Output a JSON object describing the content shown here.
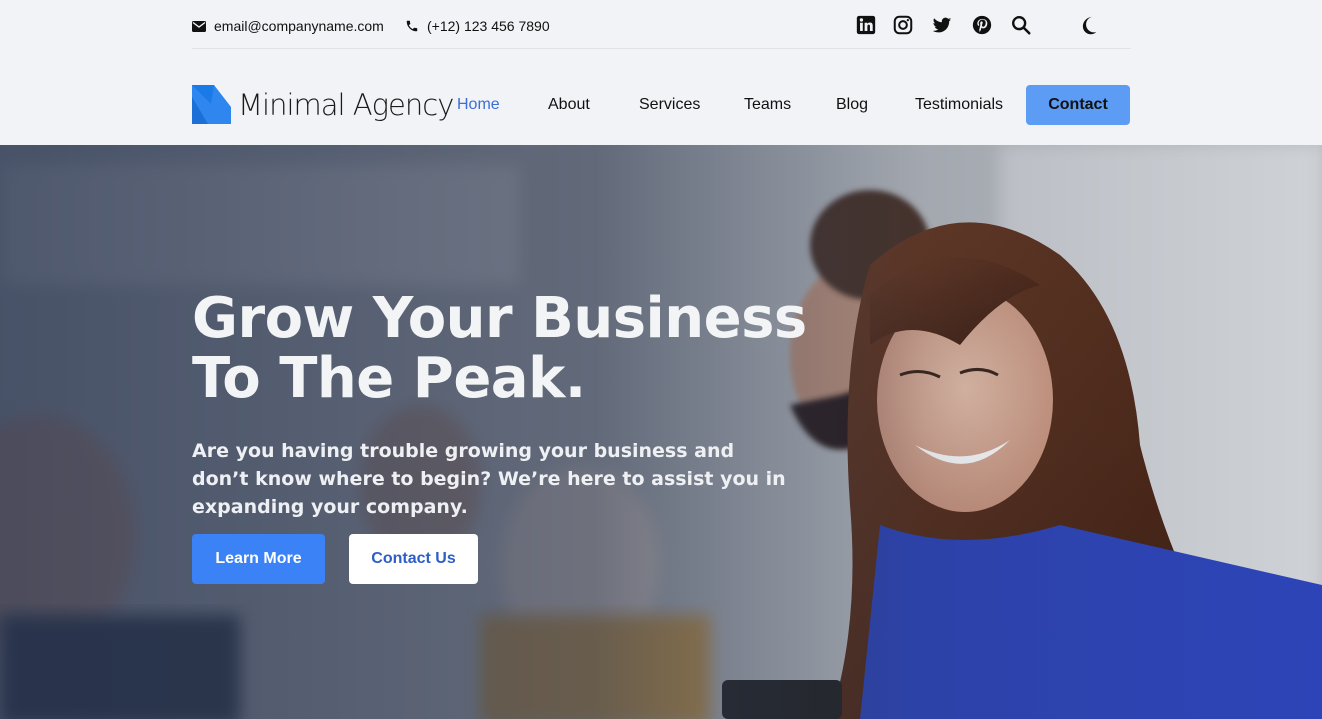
{
  "topbar": {
    "email": "email@companyname.com",
    "phone": "(+12) 123 456 7890",
    "social": [
      "linkedin-icon",
      "instagram-icon",
      "twitter-icon",
      "pinterest-icon"
    ],
    "tools": [
      "search-icon",
      "moon-icon"
    ]
  },
  "brand": {
    "name": "Minimal Agency",
    "accent": "#2f86ee"
  },
  "nav": {
    "items": [
      "Home",
      "About",
      "Services",
      "Teams",
      "Blog",
      "Testimonials"
    ],
    "active": "Home",
    "cta": "Contact"
  },
  "hero": {
    "title_line1": "Grow Your Business",
    "title_line2": "To The Peak.",
    "subtitle": "Are you having trouble growing your business and don’t know where to begin? We’re here to assist you in expanding your company.",
    "primary_button": "Learn More",
    "secondary_button": "Contact Us"
  },
  "colors": {
    "primary": "#3b82f6",
    "nav_cta": "#5c9cf5",
    "active_link": "#3b6fd8",
    "header_bg": "#f1f3f6"
  }
}
